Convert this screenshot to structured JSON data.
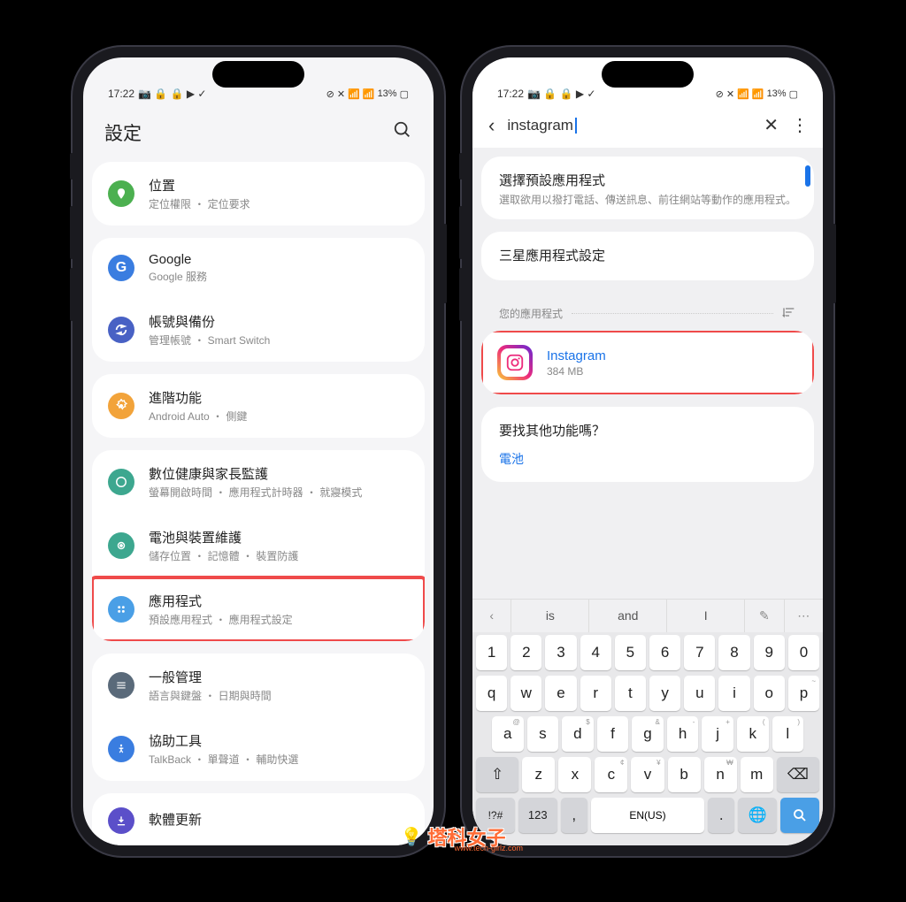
{
  "status": {
    "time": "17:22",
    "battery": "13%"
  },
  "left": {
    "header_title": "設定",
    "items": [
      {
        "title": "位置",
        "sub": "定位權限 ・ 定位要求",
        "color": "#4cb050"
      },
      {
        "title": "Google",
        "sub": "Google 服務",
        "color": "#3a7de0"
      },
      {
        "title": "帳號與備份",
        "sub": "管理帳號 ・ Smart Switch",
        "color": "#4861c4"
      },
      {
        "title": "進階功能",
        "sub": "Android Auto ・ 側鍵",
        "color": "#f2a33a"
      },
      {
        "title": "數位健康與家長監護",
        "sub": "螢幕開啟時間 ・ 應用程式計時器 ・ 就寢模式",
        "color": "#3da78f"
      },
      {
        "title": "電池與裝置維護",
        "sub": "儲存位置 ・ 記憶體 ・ 裝置防護",
        "color": "#3da78f"
      },
      {
        "title": "應用程式",
        "sub": "預設應用程式 ・ 應用程式設定",
        "color": "#4a9fe6",
        "highlight": true
      },
      {
        "title": "一般管理",
        "sub": "語言與鍵盤 ・ 日期與時間",
        "color": "#5a6a7a"
      },
      {
        "title": "協助工具",
        "sub": "TalkBack ・ 單聲道 ・ 輔助快選",
        "color": "#3a7de0"
      },
      {
        "title": "軟體更新",
        "sub": "",
        "color": "#5b4fc9"
      }
    ]
  },
  "right": {
    "search_query": "instagram",
    "default_title": "選擇預設應用程式",
    "default_desc": "選取欲用以撥打電話、傳送訊息、前往網站等動作的應用程式。",
    "samsung_section": "三星應用程式設定",
    "your_apps": "您的應用程式",
    "app": {
      "name": "Instagram",
      "size": "384 MB"
    },
    "other_q": "要找其他功能嗎？",
    "other_link": "電池",
    "suggestions": [
      "is",
      "and",
      "I"
    ],
    "kb": {
      "nums": [
        "1",
        "2",
        "3",
        "4",
        "5",
        "6",
        "7",
        "8",
        "9",
        "0"
      ],
      "row1": [
        "q",
        "w",
        "e",
        "r",
        "t",
        "y",
        "u",
        "i",
        "o",
        "p"
      ],
      "row1_sup": [
        "",
        "",
        "",
        "",
        "",
        "",
        "",
        "",
        "",
        "~"
      ],
      "row2": [
        "a",
        "s",
        "d",
        "f",
        "g",
        "h",
        "j",
        "k",
        "l"
      ],
      "row2_sup": [
        "@",
        "",
        "$",
        "",
        "&",
        "-",
        "+",
        "(",
        ")"
      ],
      "row3": [
        "z",
        "x",
        "c",
        "v",
        "b",
        "n",
        "m"
      ],
      "row3_sup": [
        "",
        "",
        "¢",
        "¥",
        "",
        "₩",
        ""
      ],
      "bottom": {
        "sym": "!?#",
        "num": "123",
        "comma": ",",
        "space": "EN(US)",
        "dot": "."
      }
    }
  },
  "watermark": {
    "text": "塔科女子",
    "url": "www.tech-girlz.com"
  }
}
